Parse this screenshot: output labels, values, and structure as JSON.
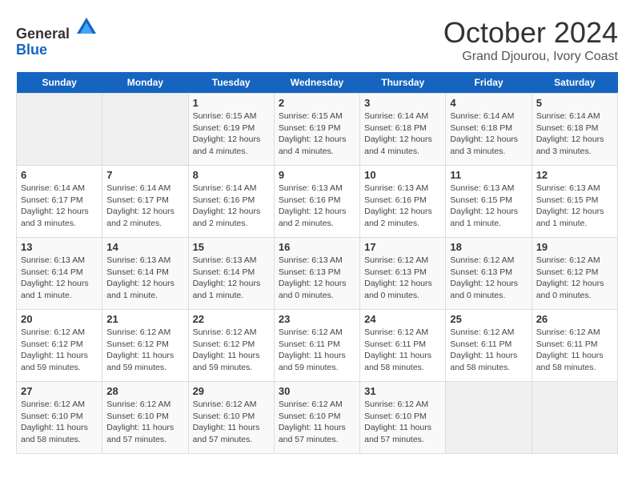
{
  "header": {
    "logo_general": "General",
    "logo_blue": "Blue",
    "month_year": "October 2024",
    "location": "Grand Djourou, Ivory Coast"
  },
  "days_of_week": [
    "Sunday",
    "Monday",
    "Tuesday",
    "Wednesday",
    "Thursday",
    "Friday",
    "Saturday"
  ],
  "weeks": [
    [
      {
        "date": "",
        "sunrise": "",
        "sunset": "",
        "daylight": ""
      },
      {
        "date": "",
        "sunrise": "",
        "sunset": "",
        "daylight": ""
      },
      {
        "date": "1",
        "sunrise": "Sunrise: 6:15 AM",
        "sunset": "Sunset: 6:19 PM",
        "daylight": "Daylight: 12 hours and 4 minutes."
      },
      {
        "date": "2",
        "sunrise": "Sunrise: 6:15 AM",
        "sunset": "Sunset: 6:19 PM",
        "daylight": "Daylight: 12 hours and 4 minutes."
      },
      {
        "date": "3",
        "sunrise": "Sunrise: 6:14 AM",
        "sunset": "Sunset: 6:18 PM",
        "daylight": "Daylight: 12 hours and 4 minutes."
      },
      {
        "date": "4",
        "sunrise": "Sunrise: 6:14 AM",
        "sunset": "Sunset: 6:18 PM",
        "daylight": "Daylight: 12 hours and 3 minutes."
      },
      {
        "date": "5",
        "sunrise": "Sunrise: 6:14 AM",
        "sunset": "Sunset: 6:18 PM",
        "daylight": "Daylight: 12 hours and 3 minutes."
      }
    ],
    [
      {
        "date": "6",
        "sunrise": "Sunrise: 6:14 AM",
        "sunset": "Sunset: 6:17 PM",
        "daylight": "Daylight: 12 hours and 3 minutes."
      },
      {
        "date": "7",
        "sunrise": "Sunrise: 6:14 AM",
        "sunset": "Sunset: 6:17 PM",
        "daylight": "Daylight: 12 hours and 2 minutes."
      },
      {
        "date": "8",
        "sunrise": "Sunrise: 6:14 AM",
        "sunset": "Sunset: 6:16 PM",
        "daylight": "Daylight: 12 hours and 2 minutes."
      },
      {
        "date": "9",
        "sunrise": "Sunrise: 6:13 AM",
        "sunset": "Sunset: 6:16 PM",
        "daylight": "Daylight: 12 hours and 2 minutes."
      },
      {
        "date": "10",
        "sunrise": "Sunrise: 6:13 AM",
        "sunset": "Sunset: 6:16 PM",
        "daylight": "Daylight: 12 hours and 2 minutes."
      },
      {
        "date": "11",
        "sunrise": "Sunrise: 6:13 AM",
        "sunset": "Sunset: 6:15 PM",
        "daylight": "Daylight: 12 hours and 1 minute."
      },
      {
        "date": "12",
        "sunrise": "Sunrise: 6:13 AM",
        "sunset": "Sunset: 6:15 PM",
        "daylight": "Daylight: 12 hours and 1 minute."
      }
    ],
    [
      {
        "date": "13",
        "sunrise": "Sunrise: 6:13 AM",
        "sunset": "Sunset: 6:14 PM",
        "daylight": "Daylight: 12 hours and 1 minute."
      },
      {
        "date": "14",
        "sunrise": "Sunrise: 6:13 AM",
        "sunset": "Sunset: 6:14 PM",
        "daylight": "Daylight: 12 hours and 1 minute."
      },
      {
        "date": "15",
        "sunrise": "Sunrise: 6:13 AM",
        "sunset": "Sunset: 6:14 PM",
        "daylight": "Daylight: 12 hours and 1 minute."
      },
      {
        "date": "16",
        "sunrise": "Sunrise: 6:13 AM",
        "sunset": "Sunset: 6:13 PM",
        "daylight": "Daylight: 12 hours and 0 minutes."
      },
      {
        "date": "17",
        "sunrise": "Sunrise: 6:12 AM",
        "sunset": "Sunset: 6:13 PM",
        "daylight": "Daylight: 12 hours and 0 minutes."
      },
      {
        "date": "18",
        "sunrise": "Sunrise: 6:12 AM",
        "sunset": "Sunset: 6:13 PM",
        "daylight": "Daylight: 12 hours and 0 minutes."
      },
      {
        "date": "19",
        "sunrise": "Sunrise: 6:12 AM",
        "sunset": "Sunset: 6:12 PM",
        "daylight": "Daylight: 12 hours and 0 minutes."
      }
    ],
    [
      {
        "date": "20",
        "sunrise": "Sunrise: 6:12 AM",
        "sunset": "Sunset: 6:12 PM",
        "daylight": "Daylight: 11 hours and 59 minutes."
      },
      {
        "date": "21",
        "sunrise": "Sunrise: 6:12 AM",
        "sunset": "Sunset: 6:12 PM",
        "daylight": "Daylight: 11 hours and 59 minutes."
      },
      {
        "date": "22",
        "sunrise": "Sunrise: 6:12 AM",
        "sunset": "Sunset: 6:12 PM",
        "daylight": "Daylight: 11 hours and 59 minutes."
      },
      {
        "date": "23",
        "sunrise": "Sunrise: 6:12 AM",
        "sunset": "Sunset: 6:11 PM",
        "daylight": "Daylight: 11 hours and 59 minutes."
      },
      {
        "date": "24",
        "sunrise": "Sunrise: 6:12 AM",
        "sunset": "Sunset: 6:11 PM",
        "daylight": "Daylight: 11 hours and 58 minutes."
      },
      {
        "date": "25",
        "sunrise": "Sunrise: 6:12 AM",
        "sunset": "Sunset: 6:11 PM",
        "daylight": "Daylight: 11 hours and 58 minutes."
      },
      {
        "date": "26",
        "sunrise": "Sunrise: 6:12 AM",
        "sunset": "Sunset: 6:11 PM",
        "daylight": "Daylight: 11 hours and 58 minutes."
      }
    ],
    [
      {
        "date": "27",
        "sunrise": "Sunrise: 6:12 AM",
        "sunset": "Sunset: 6:10 PM",
        "daylight": "Daylight: 11 hours and 58 minutes."
      },
      {
        "date": "28",
        "sunrise": "Sunrise: 6:12 AM",
        "sunset": "Sunset: 6:10 PM",
        "daylight": "Daylight: 11 hours and 57 minutes."
      },
      {
        "date": "29",
        "sunrise": "Sunrise: 6:12 AM",
        "sunset": "Sunset: 6:10 PM",
        "daylight": "Daylight: 11 hours and 57 minutes."
      },
      {
        "date": "30",
        "sunrise": "Sunrise: 6:12 AM",
        "sunset": "Sunset: 6:10 PM",
        "daylight": "Daylight: 11 hours and 57 minutes."
      },
      {
        "date": "31",
        "sunrise": "Sunrise: 6:12 AM",
        "sunset": "Sunset: 6:10 PM",
        "daylight": "Daylight: 11 hours and 57 minutes."
      },
      {
        "date": "",
        "sunrise": "",
        "sunset": "",
        "daylight": ""
      },
      {
        "date": "",
        "sunrise": "",
        "sunset": "",
        "daylight": ""
      }
    ]
  ]
}
